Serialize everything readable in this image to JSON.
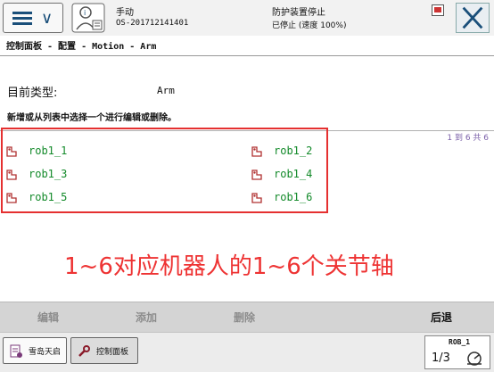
{
  "header": {
    "mode": "手动",
    "controller_id": "OS-201712141401",
    "guard_status": "防护装置停止",
    "run_state": "已停止 (速度 100%)"
  },
  "breadcrumb": "控制面板 - 配置 - Motion - Arm",
  "content": {
    "current_type_label": "目前类型:",
    "current_type_value": "Arm",
    "instruction": "新增或从列表中选择一个进行编辑或删除。",
    "pager": "1 到 6 共 6",
    "items": [
      "rob1_1",
      "rob1_2",
      "rob1_3",
      "rob1_4",
      "rob1_5",
      "rob1_6"
    ]
  },
  "annotation": "1~6对应机器人的1~6个关节轴",
  "commands": {
    "edit": "编辑",
    "add": "添加",
    "delete": "删除",
    "back": "后退"
  },
  "taskbar": {
    "task1": "雪岛天启",
    "task2": "控制面板",
    "robot": "ROB_1",
    "fraction": "1/3"
  },
  "colors": {
    "item_text": "#138a2a",
    "highlight": "#e53030",
    "annotation": "#ee3333",
    "brand_blue": "#1a4f7a"
  },
  "icons": {
    "menu": "menu-icon",
    "user": "user-info-icon",
    "close": "close-icon",
    "item": "arm-joint-icon",
    "task1": "program-icon",
    "task2": "wrench-icon",
    "speed": "speed-gauge-icon"
  }
}
